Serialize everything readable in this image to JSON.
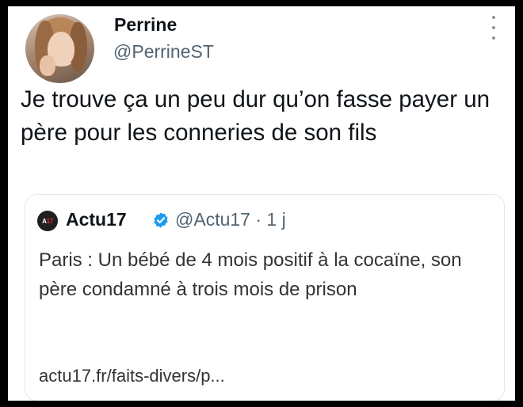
{
  "tweet": {
    "author_name": "Perrine",
    "author_handle": "@PerrineST",
    "text": "Je trouve ça un peu dur qu’on fasse payer un père pour les conneries de son fils",
    "avatar_icon": "user-avatar-photo",
    "more_icon": "more-vertical-icon"
  },
  "quoted": {
    "logo_text_left": "A",
    "logo_text_right": "17",
    "name": "Actu17",
    "verified_icon": "verified-badge-icon",
    "verified_color": "#1d9bf0",
    "handle_time": "@Actu17 · 1 j",
    "text": "Paris : Un bébé de 4 mois positif à la cocaïne, son père condamné à trois mois de prison",
    "link": "actu17.fr/faits-divers/p..."
  }
}
